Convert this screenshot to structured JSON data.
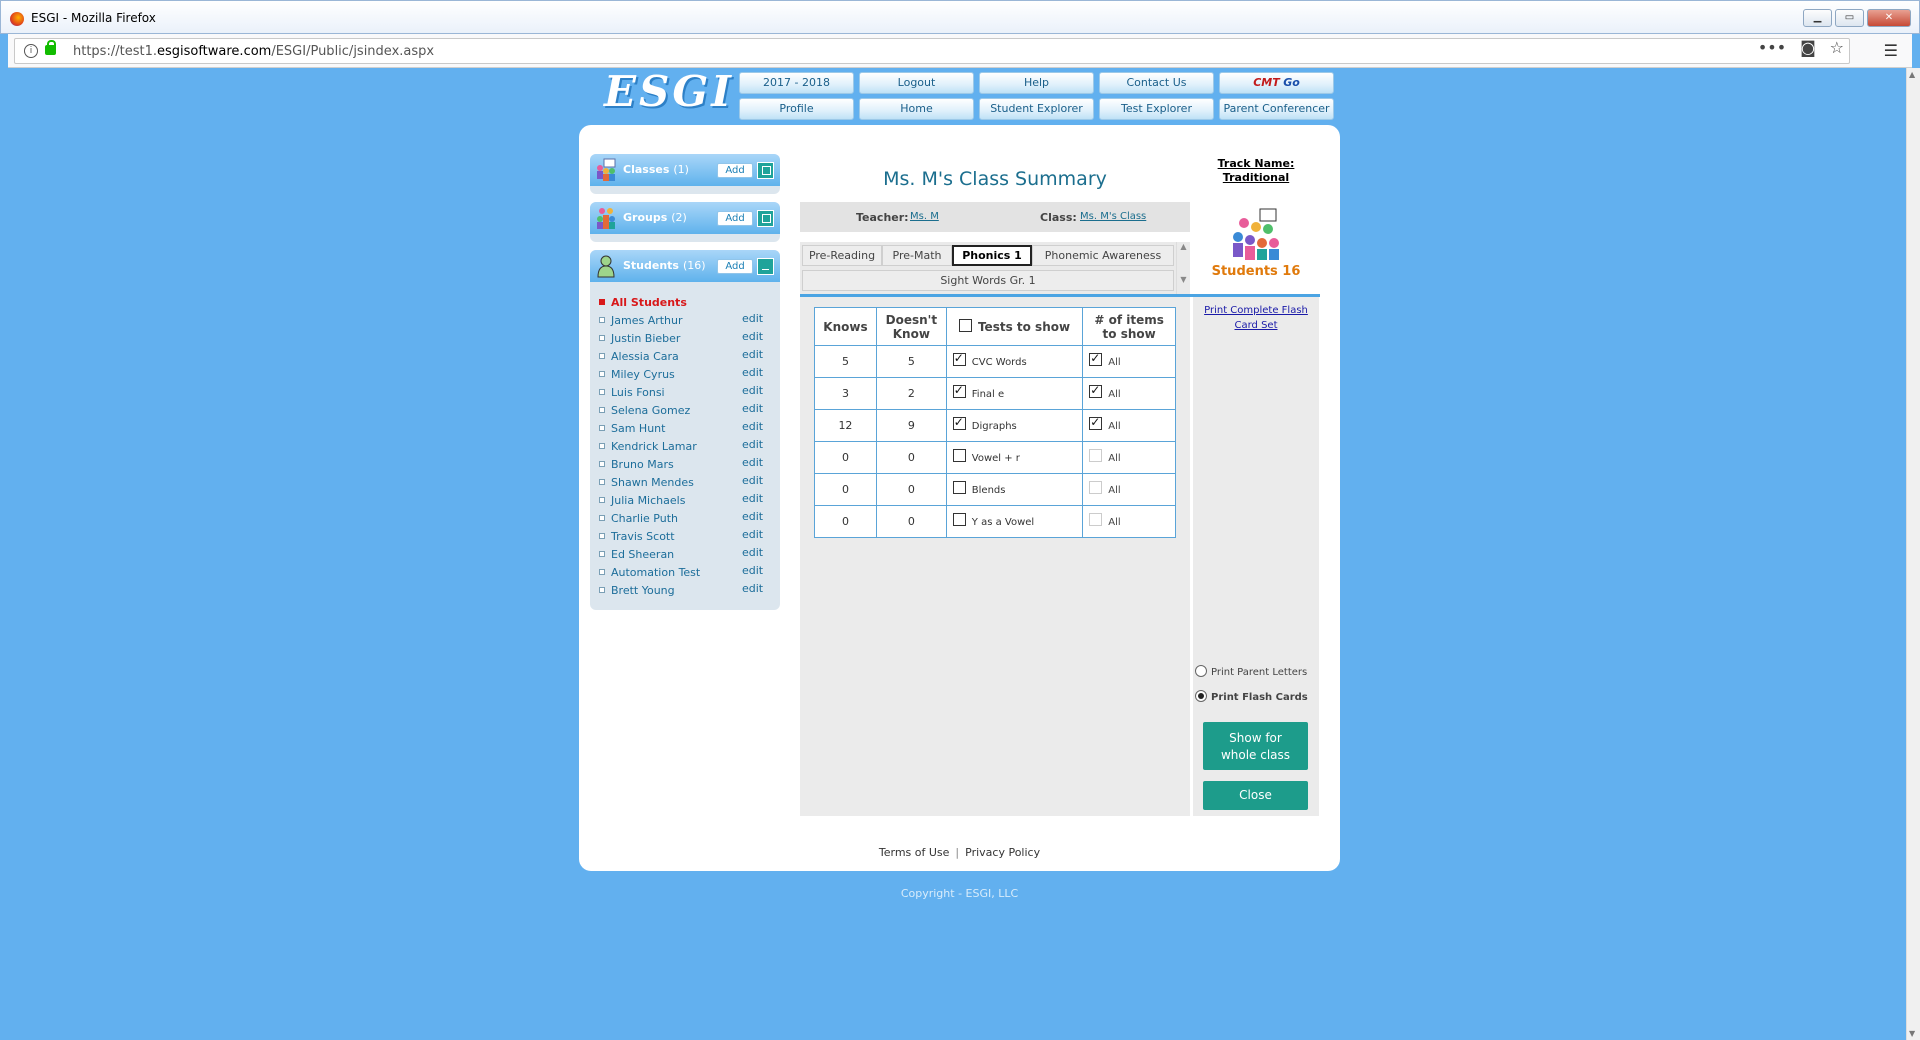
{
  "browser": {
    "window_title": "ESGI - Mozilla Firefox",
    "url_prefix": "https://test1.",
    "url_domain": "esgisoftware.com",
    "url_path": "/ESGI/Public/jsindex.aspx"
  },
  "header": {
    "logo": "ESGI",
    "nav_row1": [
      "2017 - 2018",
      "Logout",
      "Help",
      "Contact Us"
    ],
    "cmt_a": "CMT",
    "cmt_b": "Go",
    "nav_row2": [
      "Profile",
      "Home",
      "Student Explorer",
      "Test Explorer",
      "Parent Conferencer"
    ]
  },
  "sidebar": {
    "classes": {
      "label": "Classes",
      "count": "(1)",
      "add": "Add"
    },
    "groups": {
      "label": "Groups",
      "count": "(2)",
      "add": "Add"
    },
    "students": {
      "label": "Students",
      "count": "(16)",
      "add": "Add"
    },
    "all_students": "All Students",
    "edit_label": "edit",
    "student_names": [
      "James Arthur",
      "Justin Bieber",
      "Alessia Cara",
      "Miley Cyrus",
      "Luis Fonsi",
      "Selena Gomez",
      "Sam Hunt",
      "Kendrick Lamar",
      "Bruno Mars",
      "Shawn Mendes",
      "Julia Michaels",
      "Charlie Puth",
      "Travis Scott",
      "Ed Sheeran",
      "Automation Test",
      "Brett Young"
    ]
  },
  "main": {
    "title": "Ms. M's Class Summary",
    "teacher_label": "Teacher:",
    "teacher_value": "Ms. M",
    "class_label": "Class:",
    "class_value": "Ms. M's Class",
    "tabs": [
      "Pre-Reading",
      "Pre-Math",
      "Phonics 1",
      "Phonemic Awareness"
    ],
    "active_tab": "Phonics 1",
    "tab_row2": "Sight Words Gr. 1",
    "table": {
      "col_knows": "Knows",
      "col_doesnt_1": "Doesn't",
      "col_doesnt_2": "Know",
      "col_tests": "Tests to show",
      "col_items_1": "# of items",
      "col_items_2": "to show",
      "all_label": "All",
      "rows": [
        {
          "knows": "5",
          "doesnt_know": "5",
          "test": "CVC Words",
          "checked": true
        },
        {
          "knows": "3",
          "doesnt_know": "2",
          "test": "Final e",
          "checked": true
        },
        {
          "knows": "12",
          "doesnt_know": "9",
          "test": "Digraphs",
          "checked": true
        },
        {
          "knows": "0",
          "doesnt_know": "0",
          "test": "Vowel + r",
          "checked": false
        },
        {
          "knows": "0",
          "doesnt_know": "0",
          "test": "Blends",
          "checked": false
        },
        {
          "knows": "0",
          "doesnt_know": "0",
          "test": "Y as a Vowel",
          "checked": false
        }
      ]
    }
  },
  "right": {
    "track_1": "Track Name:",
    "track_2": "Traditional",
    "students_label": "Students 16",
    "print_link_1": "Print Complete Flash",
    "print_link_2": "Card Set",
    "radio_parent": "Print Parent Letters",
    "radio_flash": "Print Flash Cards",
    "selected_radio": "Print Flash Cards",
    "show_btn_1": "Show for",
    "show_btn_2": "whole class",
    "close_btn": "Close"
  },
  "footer": {
    "terms": "Terms of Use",
    "privacy": "Privacy Policy",
    "copyright": "Copyright - ESGI, LLC"
  },
  "colors": {
    "page_bg": "#62b0ef",
    "accent_teal": "#1d9c8b",
    "title_teal": "#1b6e8e",
    "alert_red": "#d8181a",
    "student_orange": "#e07a0c"
  }
}
